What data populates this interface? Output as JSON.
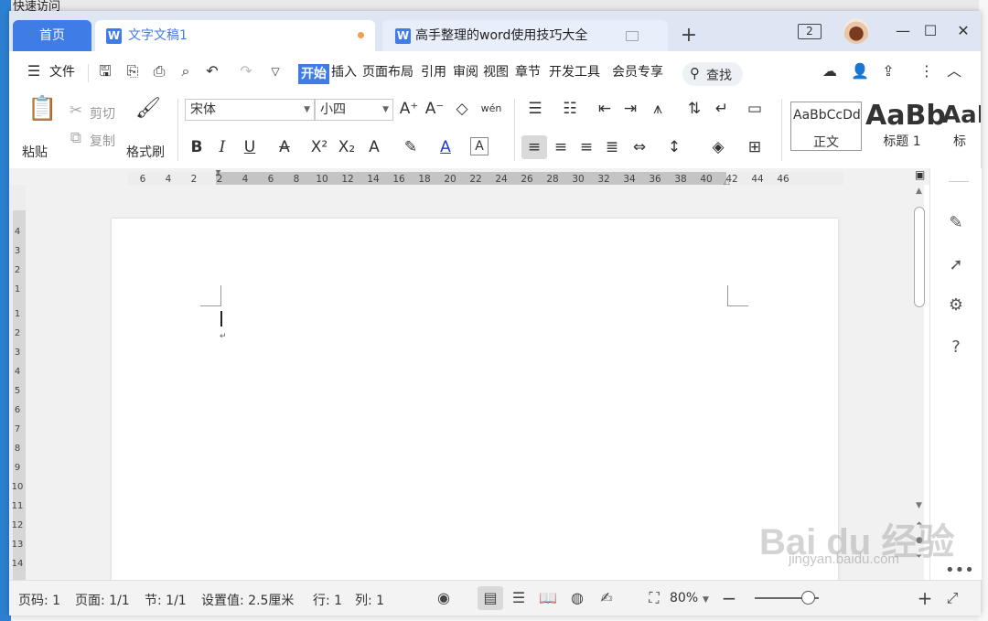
{
  "desktop": {
    "quick_access_label": "快速访问"
  },
  "titlebar": {
    "tabs": [
      {
        "label": "首页"
      },
      {
        "label": "文字文稿1"
      },
      {
        "label": "高手整理的word使用技巧大全"
      }
    ],
    "doc_icon_glyph": "W",
    "add_tab_glyph": "+",
    "window_count": "2",
    "window_controls": [
      "minimize-icon",
      "maximize-icon",
      "close-icon"
    ]
  },
  "menubar": {
    "file_label": "文件",
    "menus": [
      "开始",
      "插入",
      "页面布局",
      "引用",
      "审阅",
      "视图",
      "章节",
      "开发工具",
      "会员专享"
    ],
    "search_label": "查找"
  },
  "ribbon": {
    "paste_label": "粘贴",
    "cut_label": "剪切",
    "copy_label": "复制",
    "format_painter_label": "格式刷",
    "font_name": "宋体",
    "font_size": "小四",
    "pinyin_glyph": "wén",
    "styles": [
      {
        "preview": "AaBbCcDd",
        "label": "正文"
      },
      {
        "preview": "AaBb",
        "label": "标题 1"
      },
      {
        "preview": "AaI",
        "label": "标"
      }
    ]
  },
  "ruler": {
    "horizontal_ticks": [
      "6",
      "4",
      "2",
      "2",
      "4",
      "6",
      "8",
      "10",
      "12",
      "14",
      "16",
      "18",
      "20",
      "22",
      "24",
      "26",
      "28",
      "30",
      "32",
      "34",
      "36",
      "38",
      "40",
      "42",
      "44",
      "46"
    ],
    "vertical_ticks": [
      "4",
      "3",
      "2",
      "1",
      "1",
      "2",
      "3",
      "4",
      "5",
      "6",
      "7",
      "8",
      "9",
      "10",
      "11",
      "12",
      "13",
      "14"
    ]
  },
  "statusbar": {
    "page_num": "页码: 1",
    "page_count": "页面: 1/1",
    "section": "节: 1/1",
    "setting": "设置值: 2.5厘米",
    "row": "行: 1",
    "col": "列: 1",
    "zoom": "80%"
  },
  "watermark": {
    "brand": "Bai du 经验",
    "url": "jingyan.baidu.com"
  },
  "colors": {
    "accent": "#3f7ce6",
    "titlebar_bg": "#dee6f4",
    "modified_dot": "#f0a050"
  }
}
